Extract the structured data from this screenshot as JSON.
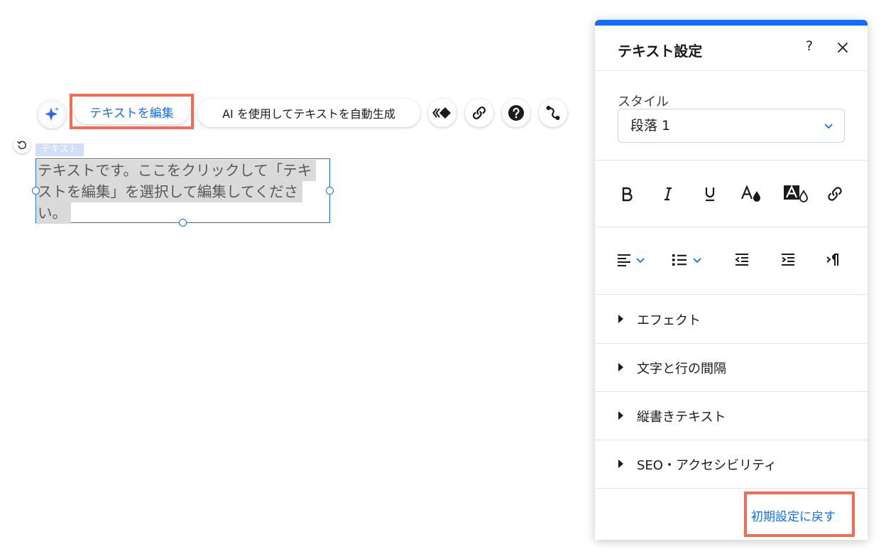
{
  "toolbar": {
    "ai_button_icon": "sparkle-icon",
    "edit_text_label": "テキストを編集",
    "ai_generate_label": "AI を使用してテキストを自動生成",
    "icons": [
      "animation-icon",
      "link-icon",
      "help-icon",
      "connect-icon"
    ]
  },
  "canvas": {
    "element_label": "テキスト",
    "text_lines": [
      "テキストです。ここをクリックして「テキ",
      "ストを編集」を選択して編集してくださ",
      "い。"
    ]
  },
  "panel": {
    "title": "テキスト設定",
    "help_label": "?",
    "style_label": "スタイル",
    "style_value": "段落 1",
    "format_icons": [
      "bold-icon",
      "italic-icon",
      "underline-icon",
      "text-color-icon",
      "highlight-icon",
      "link-icon"
    ],
    "align_icons": [
      "align-left-icon",
      "bullet-list-icon",
      "decrease-indent-icon",
      "increase-indent-icon",
      "text-direction-icon"
    ],
    "accordion": [
      {
        "label": "エフェクト"
      },
      {
        "label": "文字と行の間隔"
      },
      {
        "label": "縦書きテキスト"
      },
      {
        "label": "SEO・アクセシビリティ"
      }
    ],
    "reset_label": "初期設定に戻す"
  },
  "colors": {
    "accent": "#116dff",
    "highlight_frame": "#f26b55"
  }
}
